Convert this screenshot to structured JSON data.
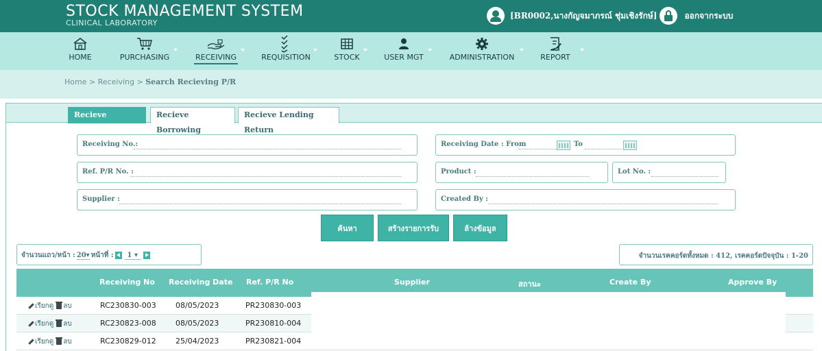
{
  "header": {
    "title": "STOCK MANAGEMENT SYSTEM",
    "subtitle": "CLINICAL LABORATORY",
    "user": "[BR0002,นางกัญจมาภรณ์ ชุ่มเชิงรักษ์]",
    "logout": "ออกจากระบบ"
  },
  "menu": [
    {
      "label": "HOME",
      "icon": "home-icon"
    },
    {
      "label": "PURCHASING",
      "icon": "cart-icon"
    },
    {
      "label": "RECEIVING",
      "icon": "hand-receive-icon",
      "active": true
    },
    {
      "label": "REQUISITION",
      "icon": "checklist-icon"
    },
    {
      "label": "STOCK",
      "icon": "grid-icon"
    },
    {
      "label": "USER MGT",
      "icon": "user-icon"
    },
    {
      "label": "ADMINISTRATION",
      "icon": "gear-icon"
    },
    {
      "label": "REPORT",
      "icon": "report-icon"
    }
  ],
  "breadcrumb": {
    "path": "Home > Receiving > ",
    "current": "Search Recieving P/R"
  },
  "tabs": [
    "Recieve Purchase",
    "Recieve Borrowing",
    "Recieve Lending Return"
  ],
  "filters": {
    "receiving_no": "Receiving No.:",
    "receiving_date_from": "Receiving Date : From",
    "to": "To",
    "ref_pr_no": "Ref. P/R No. :",
    "product": "Product :",
    "lot_no": "Lot No. :",
    "supplier": "Supplier :",
    "created_by": "Created By :"
  },
  "buttons": {
    "search": "ค้นหา",
    "create": "สร้างรายการรับ",
    "clear": "ล้างข้อมูล"
  },
  "pager": {
    "rows_label": "จำนวนแถว/หน้า :",
    "rows_value": "20",
    "page_label": "หน้าที่ :",
    "page_value": "1",
    "record_info": "จำนวนเรคคอร์ดทั้งหมด : 412, เรคคอร์ดปัจจุบัน : 1-20"
  },
  "table": {
    "headers": [
      "Receiving No",
      "Receiving Date",
      "Ref. P/R No",
      "Supplier",
      "สถานะ",
      "Create By",
      "Approve By"
    ],
    "action_view": "เรียกดู",
    "action_delete": "ลบ",
    "rows": [
      {
        "receiving_no": "RC230830-003",
        "receiving_date": "08/05/2023",
        "ref_pr_no": "PR230830-003"
      },
      {
        "receiving_no": "RC230823-008",
        "receiving_date": "08/05/2023",
        "ref_pr_no": "PR230810-004"
      },
      {
        "receiving_no": "RC230829-012",
        "receiving_date": "25/04/2023",
        "ref_pr_no": "PR230821-004"
      }
    ]
  },
  "colors": {
    "header_bg": "#1f7f74",
    "menu_bg": "#b5e8e0",
    "accent": "#3fb3a6",
    "table_header": "#67c4b8"
  }
}
